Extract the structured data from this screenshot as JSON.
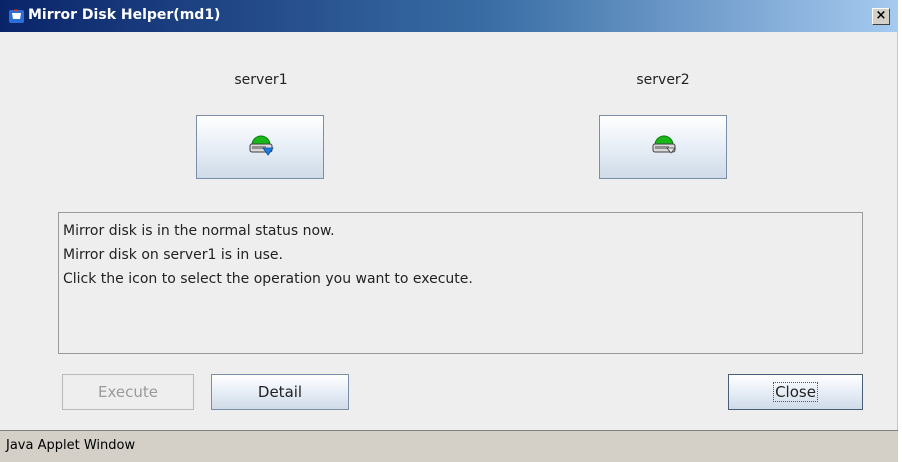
{
  "window": {
    "title": "Mirror Disk Helper(md1)",
    "close_glyph": "×",
    "icon": "java-cup-icon"
  },
  "servers": [
    {
      "label": "server1",
      "icon": "mirror-disk-active-icon"
    },
    {
      "label": "server2",
      "icon": "mirror-disk-icon"
    }
  ],
  "status": {
    "lines": [
      "Mirror disk is in the normal status now.",
      "Mirror disk on server1 is in use.",
      "Click the icon to select the operation you want to execute."
    ]
  },
  "buttons": {
    "execute": "Execute",
    "execute_enabled": false,
    "detail": "Detail",
    "close": "Close"
  },
  "footer": {
    "text": "Java Applet Window"
  },
  "colors": {
    "title_start": "#0a246a",
    "title_end": "#a6caf0",
    "disk_green": "#18b818",
    "disk_arrow_blue": "#1e7ee0"
  }
}
